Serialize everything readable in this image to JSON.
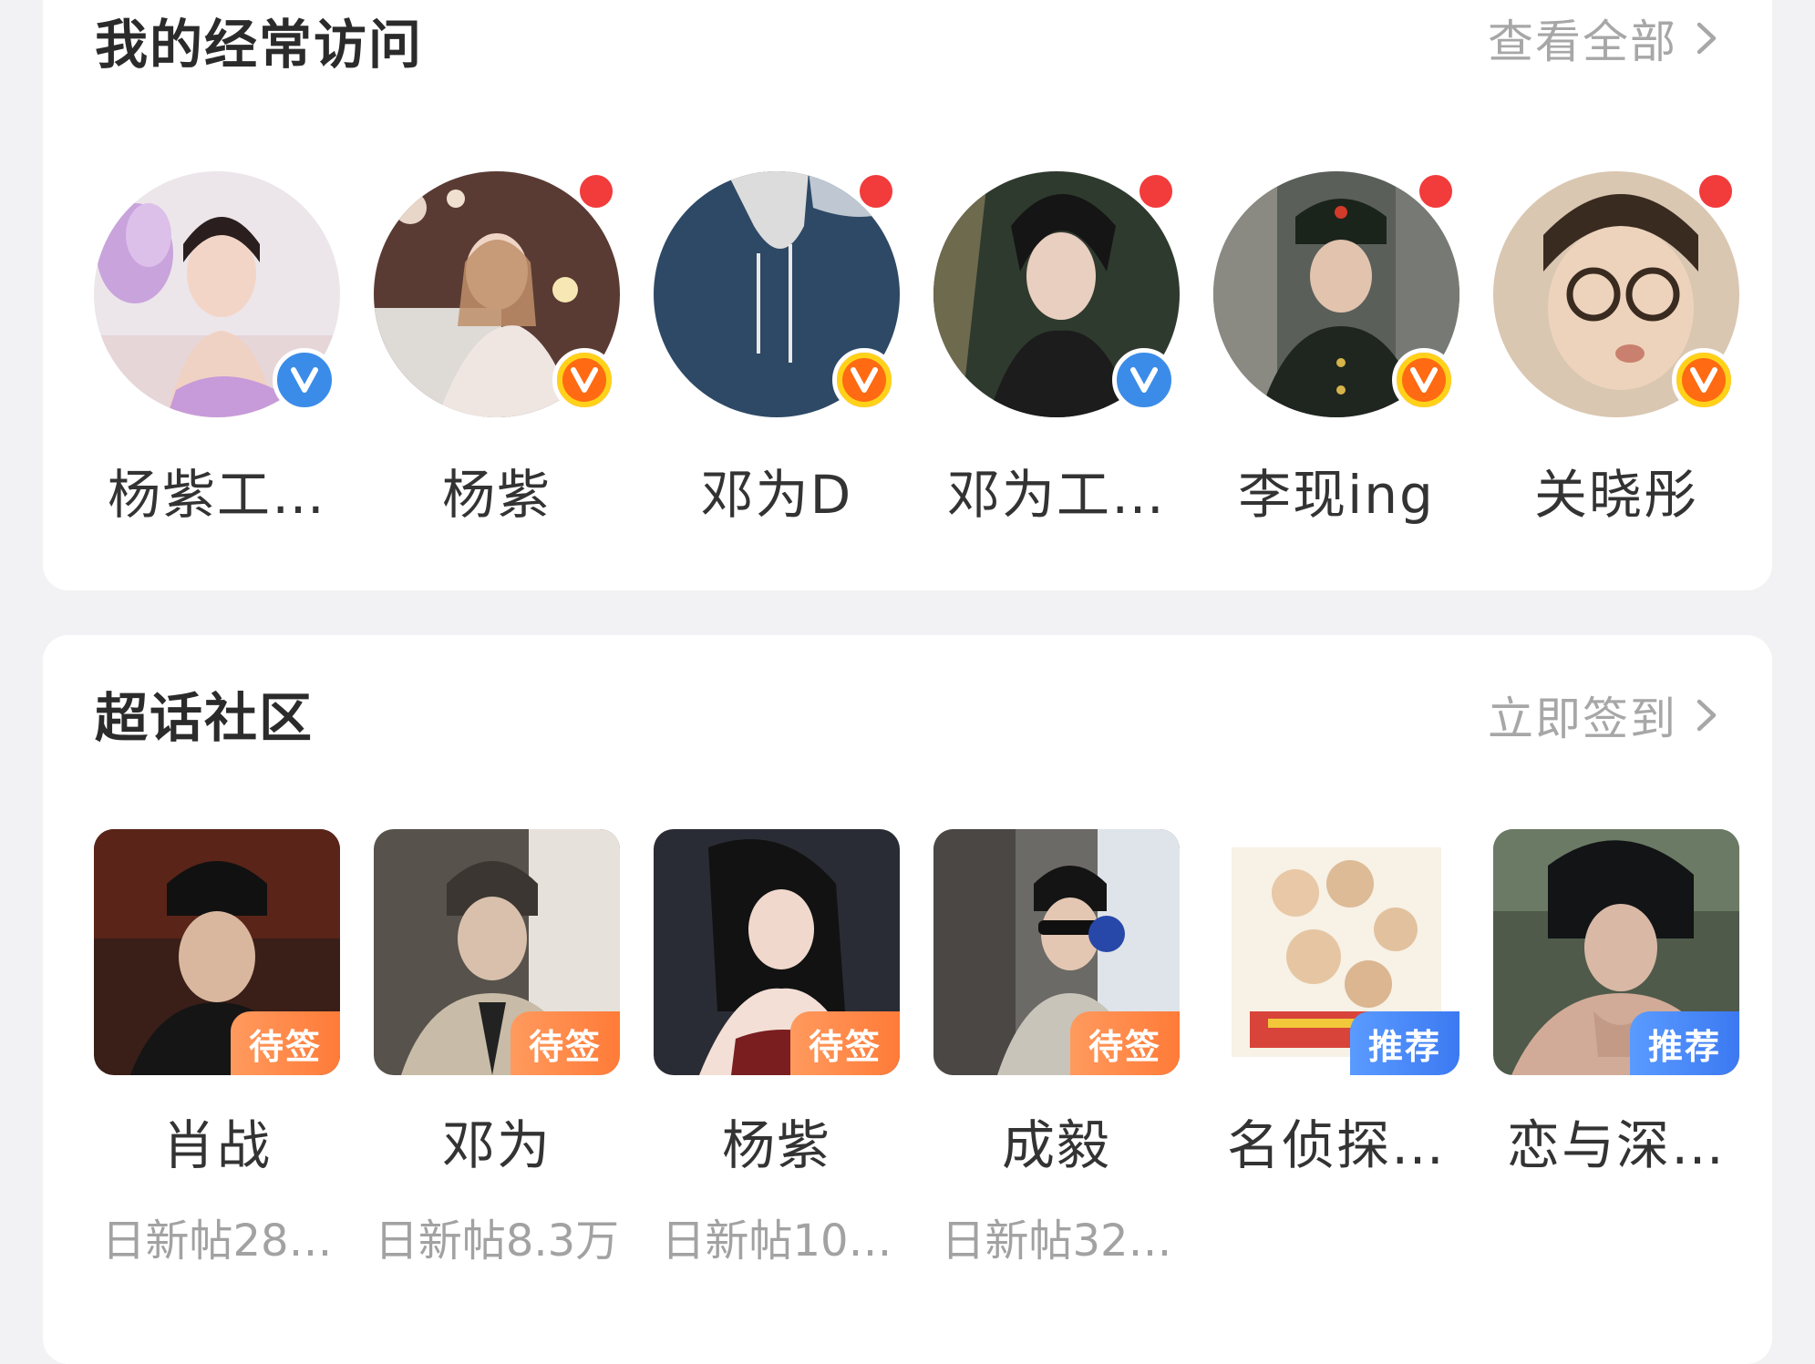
{
  "frequent_visits": {
    "title": "我的经常访问",
    "view_all_label": "查看全部",
    "items": [
      {
        "name": "杨紫工…",
        "verified": "blue",
        "has_update": false
      },
      {
        "name": "杨紫",
        "verified": "gold",
        "has_update": true
      },
      {
        "name": "邓为D",
        "verified": "gold",
        "has_update": true
      },
      {
        "name": "邓为工…",
        "verified": "blue",
        "has_update": true
      },
      {
        "name": "李现ing",
        "verified": "gold",
        "has_update": true
      },
      {
        "name": "关晓彤",
        "verified": "gold",
        "has_update": true
      }
    ]
  },
  "super_topics": {
    "title": "超话社区",
    "checkin_label": "立即签到",
    "items": [
      {
        "name": "肖战",
        "tag": "待签",
        "meta": "日新帖28…"
      },
      {
        "name": "邓为",
        "tag": "待签",
        "meta": "日新帖8.3万"
      },
      {
        "name": "杨紫",
        "tag": "待签",
        "meta": "日新帖10…"
      },
      {
        "name": "成毅",
        "tag": "待签",
        "meta": "日新帖32…"
      },
      {
        "name": "名侦探…",
        "tag": "推荐",
        "meta": ""
      },
      {
        "name": "恋与深…",
        "tag": "推荐",
        "meta": ""
      }
    ]
  },
  "colors": {
    "pending_tag": "#ff8a4a",
    "recommend_tag": "#4a8af6",
    "update_dot": "#f23b3b",
    "verified_blue": "#3b8ce8",
    "verified_gold": "#ff6a12"
  }
}
